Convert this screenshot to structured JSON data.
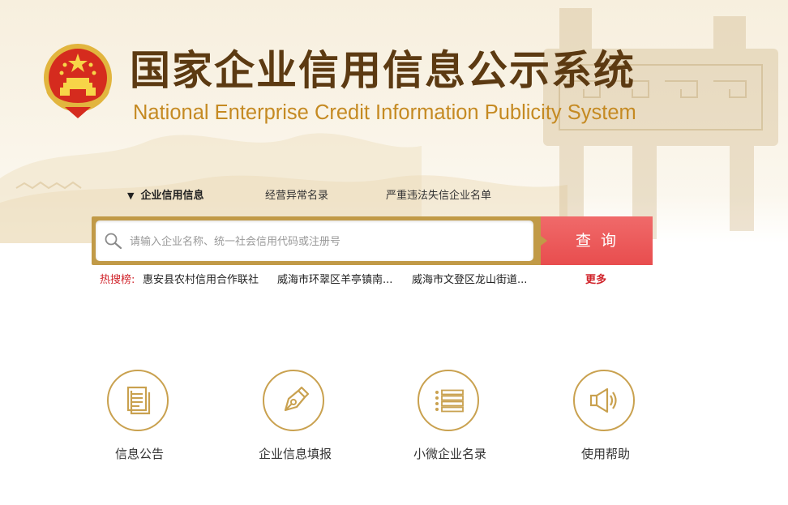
{
  "header": {
    "title_cn": "国家企业信用信息公示系统",
    "title_en": "National Enterprise Credit Information Publicity System",
    "emblem_icon": "national-emblem-icon"
  },
  "tabs": [
    {
      "label": "企业信用信息",
      "active": true,
      "marker": "▼"
    },
    {
      "label": "经营异常名录",
      "active": false
    },
    {
      "label": "严重违法失信企业名单",
      "active": false
    }
  ],
  "search": {
    "placeholder": "请输入企业名称、统一社会信用代码或注册号",
    "value": "",
    "button_label": "查询",
    "icon": "search-icon"
  },
  "hot_search": {
    "label": "热搜榜:",
    "items": [
      "惠安县农村信用合作联社",
      "威海市环翠区羊亭镇南...",
      "威海市文登区龙山街道..."
    ],
    "more_label": "更多"
  },
  "features": [
    {
      "label": "信息公告",
      "icon": "document-list-icon"
    },
    {
      "label": "企业信息填报",
      "icon": "pen-nib-icon"
    },
    {
      "label": "小微企业名录",
      "icon": "list-icon"
    },
    {
      "label": "使用帮助",
      "icon": "speaker-icon"
    }
  ],
  "colors": {
    "brand_brown": "#5c3a12",
    "brand_gold": "#c58a22",
    "search_border": "#c19a47",
    "search_button": "#e84d4e",
    "hot_red": "#d0232a",
    "icon_gold": "#c9a14f"
  }
}
